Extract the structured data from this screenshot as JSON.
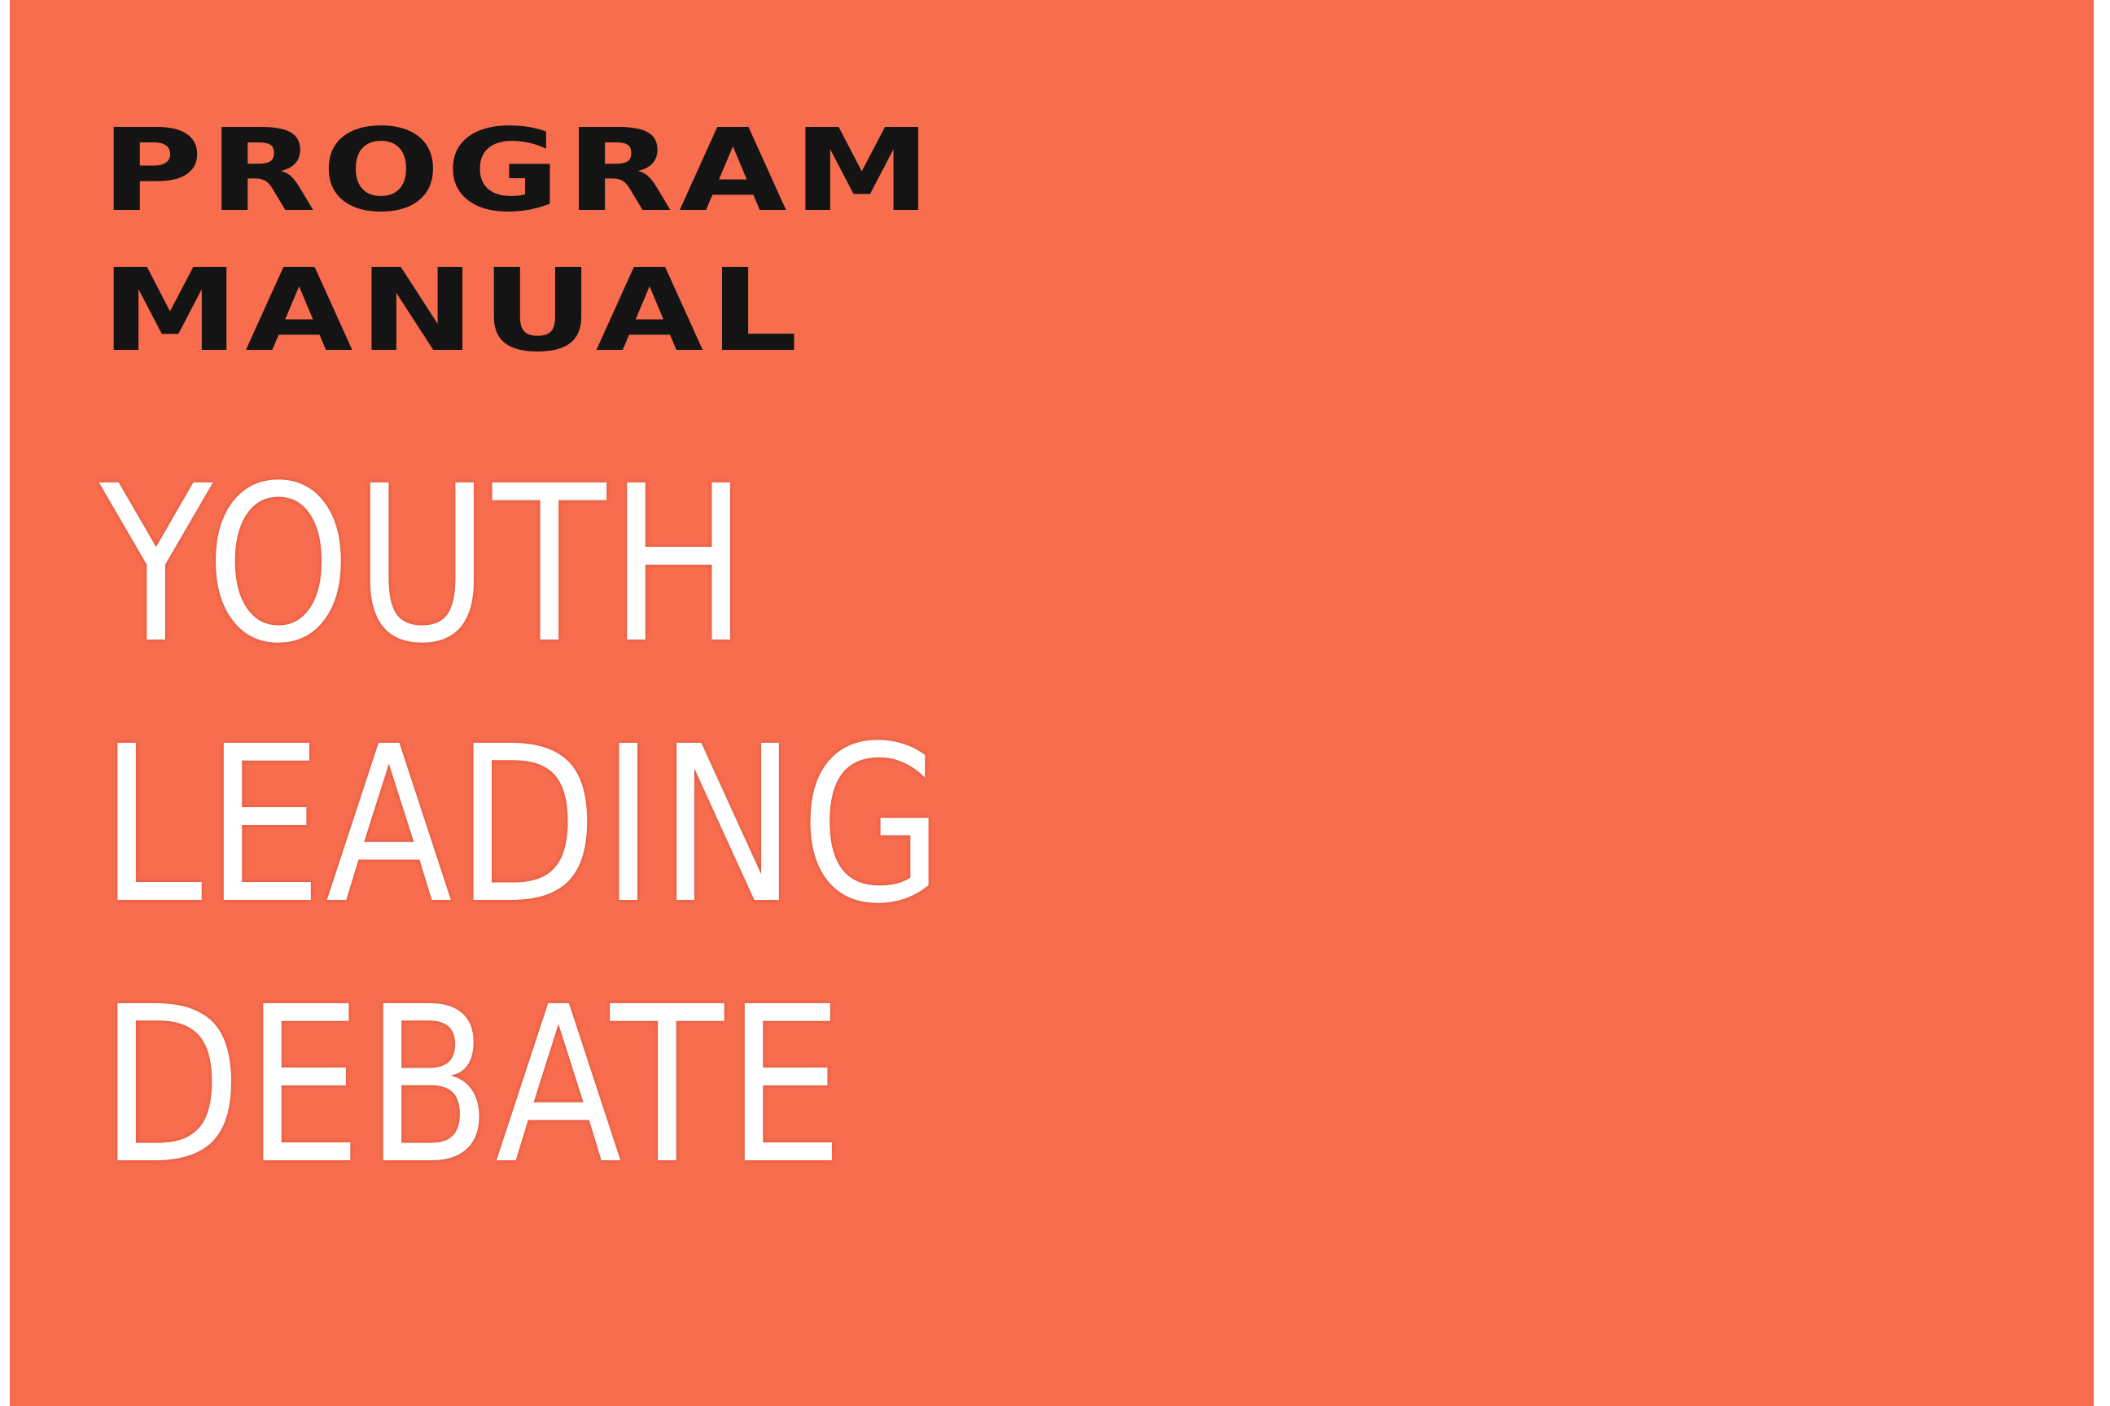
{
  "cover": {
    "background_color": "#f76d4e",
    "kicker": {
      "line1": "PROGRAM",
      "line2": "MANUAL"
    },
    "title": {
      "line1": "YOUTH",
      "line2": "LEADING",
      "line3": "DEBATE"
    }
  }
}
